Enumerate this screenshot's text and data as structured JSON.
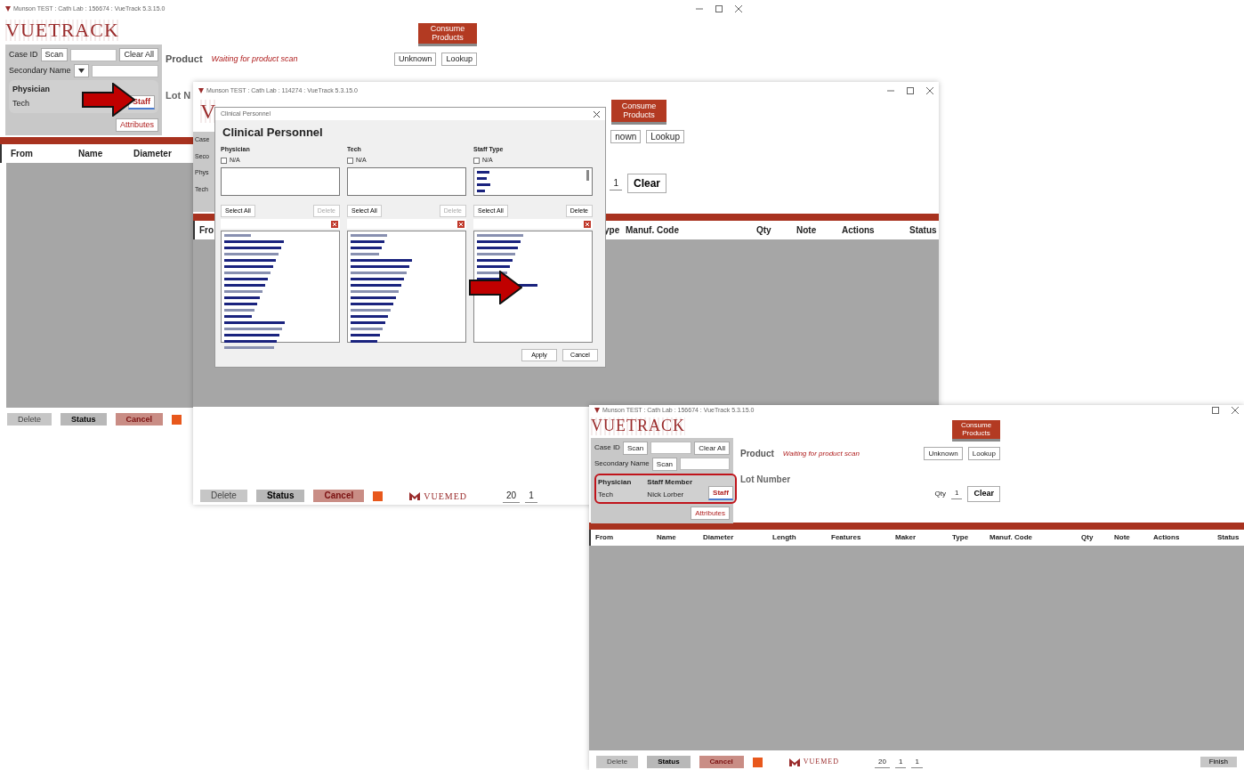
{
  "windows": [
    {
      "title": "Munson TEST : Cath Lab : 156674 : VueTrack 5.3.15.0",
      "logo": "VUETRACK",
      "consume_button": "Consume Products",
      "panel": {
        "case_id_label": "Case ID",
        "scan_button": "Scan",
        "clear_all_button": "Clear All",
        "secondary_name_label": "Secondary Name",
        "secondary": {
          "kind": "dropdown"
        },
        "personnel_headers": [
          "Physician"
        ],
        "personnel_values": [
          "Tech"
        ],
        "highlighted": false,
        "staff_button": "Staff",
        "attributes_button": "Attributes"
      },
      "product": {
        "label": "Product",
        "status": "Waiting for product scan",
        "buttons": [
          "Unknown",
          "Lookup"
        ]
      },
      "lot_label": "Lot N",
      "columns": [
        "From",
        "Name",
        "Diameter"
      ],
      "footer": {
        "buttons": [
          "Delete",
          "Status",
          "Cancel"
        ]
      }
    },
    {
      "title": "Munson TEST : Cath Lab : 114274 : VueTrack 5.3.15.0",
      "logo": "V",
      "consume_button": "Consume Products",
      "panel_fragments": [
        "Case",
        "Seco",
        "Phys",
        "Tech"
      ],
      "product": {
        "buttons": [
          "nown",
          "Lookup"
        ]
      },
      "qty": {
        "value": "1"
      },
      "clear_button": "Clear",
      "columns": [
        "Fro",
        "ype",
        "Manuf. Code",
        "Qty",
        "Note",
        "Actions",
        "Status"
      ],
      "footer": {
        "buttons": [
          "Delete",
          "Status",
          "Cancel"
        ],
        "brand": "VUEMED",
        "pager": [
          "20",
          "1"
        ]
      }
    },
    {
      "title": "Munson TEST : Cath Lab : 156674 : VueTrack 5.3.15.0",
      "logo": "VUETRACK",
      "consume_button": "Consume Products",
      "panel": {
        "case_id_label": "Case ID",
        "scan_button": "Scan",
        "clear_all_button": "Clear All",
        "secondary_name_label": "Secondary Name",
        "secondary": {
          "kind": "button",
          "label": "Scan"
        },
        "personnel_headers": [
          "Physician",
          "Staff Member"
        ],
        "personnel_values": [
          "Tech",
          "Nick Lorber"
        ],
        "highlighted": true,
        "staff_button": "Staff",
        "attributes_button": "Attributes"
      },
      "product": {
        "label": "Product",
        "status": "Waiting for product scan",
        "buttons": [
          "Unknown",
          "Lookup"
        ]
      },
      "lot_label": "Lot Number",
      "qty": {
        "label": "Qty",
        "value": "1"
      },
      "clear_button": "Clear",
      "columns": [
        "From",
        "Name",
        "Diameter",
        "Length",
        "Features",
        "Maker",
        "Type",
        "Manuf. Code",
        "Qty",
        "Note",
        "Actions",
        "Status"
      ],
      "footer": {
        "buttons": [
          "Delete",
          "Status",
          "Cancel"
        ],
        "brand": "VUEMED",
        "pager": [
          "20",
          "1",
          "1"
        ],
        "finish": "Finish"
      }
    }
  ],
  "dialog": {
    "window_title": "Clinical Personnel",
    "heading": "Clinical Personnel",
    "columns": [
      {
        "label": "Physician",
        "na_label": "N/A",
        "na_checked": false,
        "has_selection": false,
        "select_all": "Select All",
        "delete": "Delete",
        "delete_disabled": true
      },
      {
        "label": "Tech",
        "na_label": "N/A",
        "na_checked": false,
        "has_selection": false,
        "select_all": "Select All",
        "delete": "Delete",
        "delete_disabled": true
      },
      {
        "label": "Staff Type",
        "na_label": "N/A",
        "na_checked": false,
        "has_selection": true,
        "select_all": "Select All",
        "delete": "Delete",
        "delete_disabled": false
      }
    ],
    "buttons": [
      "Apply",
      "Cancel"
    ]
  }
}
